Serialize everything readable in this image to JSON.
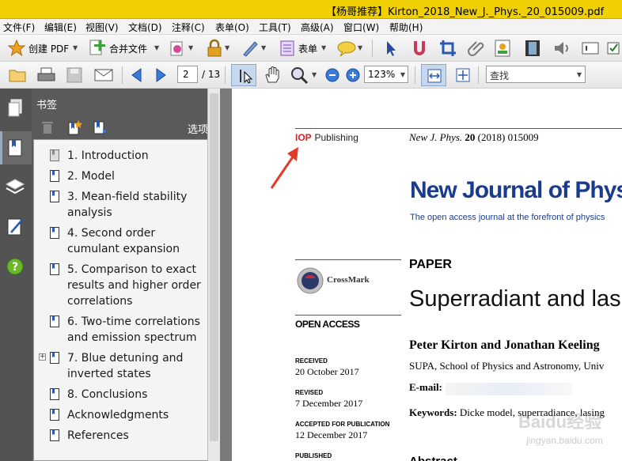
{
  "window": {
    "title": "【杨哥推荐】Kirton_2018_New_J._Phys._20_015009.pdf"
  },
  "menu": [
    "文件(F)",
    "编辑(E)",
    "视图(V)",
    "文档(D)",
    "注释(C)",
    "表单(O)",
    "工具(T)",
    "高级(A)",
    "窗口(W)",
    "帮助(H)"
  ],
  "toolbar1": {
    "create_pdf": "创建 PDF",
    "merge": "合并文件",
    "forms": "表单"
  },
  "toolbar2": {
    "page_current": "2",
    "page_total": "/ 13",
    "zoom": "123%",
    "search": "查找"
  },
  "bookmarks_panel": {
    "title": "书签",
    "close": "×",
    "options": "选项",
    "items": [
      {
        "label": "1. Introduction"
      },
      {
        "label": "2. Model"
      },
      {
        "label": "3. Mean-field stability analysis"
      },
      {
        "label": "4. Second order cumulant expansion"
      },
      {
        "label": "5. Comparison to exact results and higher order correlations"
      },
      {
        "label": "6. Two-time correlations and emission spectrum"
      },
      {
        "label": "7. Blue detuning and inverted states",
        "expand": "+"
      },
      {
        "label": "8. Conclusions"
      },
      {
        "label": "Acknowledgments"
      },
      {
        "label": "References"
      }
    ]
  },
  "document": {
    "publisher_mark": "IOP",
    "publisher_word": "Publishing",
    "citation_journal": "New J. Phys.",
    "citation_volume": "20",
    "citation_rest": "(2018) 015009",
    "journal_name": "New Journal of Phys",
    "journal_tagline": "The open access journal at the forefront of physics",
    "crossmark": "CrossMark",
    "open_access": "OPEN ACCESS",
    "section_label": "PAPER",
    "paper_title": "Superradiant and lasin",
    "authors": "Peter Kirton and Jonathan Keeling",
    "affiliation": "SUPA, School of Physics and Astronomy, Univ",
    "email_label": "E-mail:",
    "keywords_label": "Keywords:",
    "keywords_value": "Dicke model, superradiance, lasing",
    "received_label": "RECEIVED",
    "received_date": "20 October 2017",
    "revised_label": "REVISED",
    "revised_date": "7 December 2017",
    "accepted_label": "ACCEPTED FOR PUBLICATION",
    "accepted_date": "12 December 2017",
    "published_label": "PUBLISHED",
    "abstract_partial": "Abstract"
  },
  "watermark": {
    "text": "Baidu经验",
    "subtext": "jingyan.baidu.com"
  },
  "colors": {
    "titlebar": "#f0d000",
    "journal_blue": "#1b3c8c",
    "arrow_red": "#e23b2a",
    "panel_bg": "#5a5a5a"
  }
}
